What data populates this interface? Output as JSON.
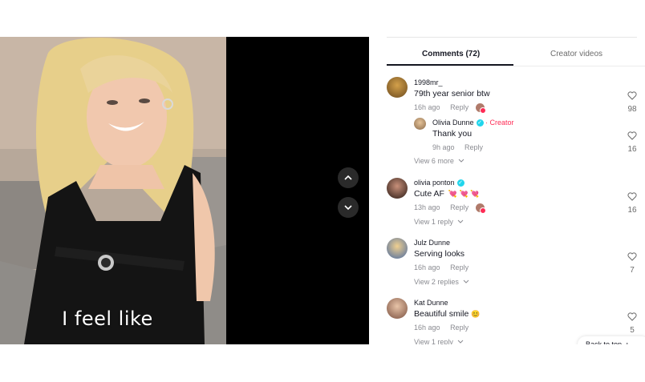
{
  "video": {
    "caption": "I feel like"
  },
  "tabs": [
    {
      "label": "Comments (72)"
    },
    {
      "label": "Creator videos"
    }
  ],
  "comments": [
    {
      "username": "1998mr_",
      "text": "79th year senior btw",
      "time": "16h ago",
      "reply": "Reply",
      "likes": "98"
    },
    {
      "username": "Olivia Dunne",
      "creator_label": "· Creator",
      "text": "Thank you",
      "time": "9h ago",
      "reply": "Reply",
      "likes": "16"
    },
    {
      "view_more": "View 6 more"
    },
    {
      "username": "olivia ponton",
      "text": "Cute AF",
      "time": "13h ago",
      "reply": "Reply",
      "likes": "16",
      "view_replies": "View 1 reply"
    },
    {
      "username": "Julz Dunne",
      "text": "Serving looks",
      "time": "16h ago",
      "reply": "Reply",
      "likes": "7",
      "view_replies": "View 2 replies"
    },
    {
      "username": "Kat Dunne",
      "text": "Beautiful smile",
      "time": "16h ago",
      "reply": "Reply",
      "likes": "5",
      "view_replies": "View 1 reply"
    }
  ],
  "back_to_top": "Back to top",
  "colors": {
    "accent": "#fe2c55",
    "verified": "#20d5ec"
  }
}
